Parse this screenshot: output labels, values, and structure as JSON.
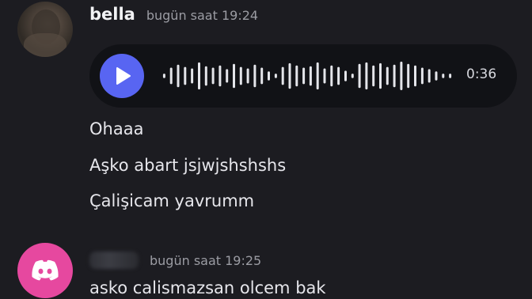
{
  "messages": [
    {
      "author": "bella",
      "timestamp": "bugün saat 19:24",
      "voice": {
        "duration": "0:36",
        "playing": false
      },
      "lines": [
        "Ohaaa",
        "Aşko abart jsjwjshshshs",
        "Çalişicam yavrumm"
      ]
    },
    {
      "author": "",
      "timestamp": "bugün saat 19:25",
      "lines": [
        "asko calismazsan olcem bak"
      ]
    }
  ],
  "colors": {
    "background": "#1c1c21",
    "voice_bg": "#111216",
    "play_button": "#5865f2",
    "discord_avatar": "#e6489f",
    "timestamp": "#9b9ca3"
  },
  "icons": {
    "play": "play-icon",
    "default_avatar": "discord-logo-icon"
  }
}
